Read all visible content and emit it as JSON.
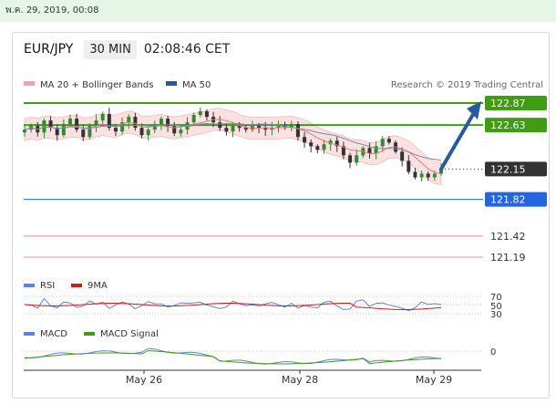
{
  "timestamp": "พ.ค. 29, 2019, 00:08",
  "header": {
    "pair": "EUR/JPY",
    "timeframe": "30 MIN",
    "clock": "02:08:46 CET"
  },
  "legend": {
    "bollinger": "MA 20 + Bollinger Bands",
    "ma50": "MA 50",
    "credit": "Research © 2019 Trading Central"
  },
  "colors": {
    "green": "#3f9c13",
    "blue": "#2465e0",
    "navy": "#2a5a9e",
    "red": "#f2a4a8",
    "dark": "#333333",
    "rsi": "#5f86d6",
    "nine": "#d11a1a"
  },
  "chart_data": [
    {
      "type": "candlestick",
      "title": "EUR/JPY",
      "x_ticks": [
        "May 26",
        "May 28",
        "May 29"
      ],
      "levels": [
        {
          "value": 122.87,
          "label": "122.87",
          "style": "resistance"
        },
        {
          "value": 122.63,
          "label": "122.63",
          "style": "resistance"
        },
        {
          "value": 122.15,
          "label": "122.15",
          "style": "last"
        },
        {
          "value": 121.82,
          "label": "121.82",
          "style": "pivot"
        },
        {
          "value": 121.42,
          "label": "121.42",
          "style": "support"
        },
        {
          "value": 121.19,
          "label": "121.19",
          "style": "support"
        }
      ],
      "close_approx": [
        122.58,
        122.62,
        122.55,
        122.68,
        122.6,
        122.52,
        122.64,
        122.7,
        122.58,
        122.5,
        122.62,
        122.68,
        122.75,
        122.6,
        122.56,
        122.66,
        122.72,
        122.6,
        122.52,
        122.58,
        122.64,
        122.7,
        122.62,
        122.54,
        122.58,
        122.66,
        122.74,
        122.78,
        122.72,
        122.66,
        122.6,
        122.56,
        122.62,
        122.6,
        122.58,
        122.62,
        122.6,
        122.58,
        122.6,
        122.62,
        122.6,
        122.64,
        122.5,
        122.44,
        122.4,
        122.36,
        122.42,
        122.46,
        122.4,
        122.3,
        122.22,
        122.3,
        122.38,
        122.32,
        122.4,
        122.48,
        122.44,
        122.34,
        122.24,
        122.12,
        122.06,
        122.1,
        122.06,
        122.1,
        122.15
      ],
      "forecast": {
        "from": 122.15,
        "to": 122.87
      }
    },
    {
      "type": "line",
      "title": "RSI",
      "series": [
        {
          "name": "RSI"
        },
        {
          "name": "9MA"
        }
      ],
      "levels": [
        "70",
        "50",
        "30"
      ]
    },
    {
      "type": "line",
      "title": "MACD",
      "series": [
        {
          "name": "MACD"
        },
        {
          "name": "MACD Signal"
        }
      ],
      "levels": [
        "0"
      ]
    }
  ]
}
